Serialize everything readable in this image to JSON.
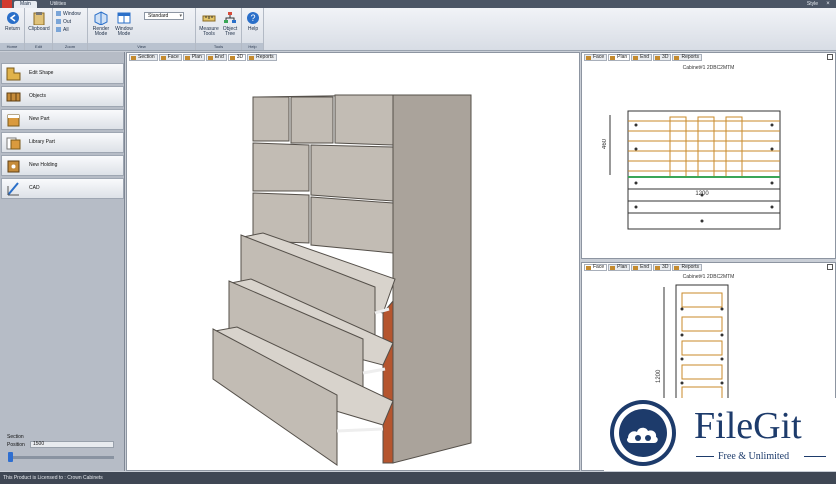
{
  "titlebar": {
    "tabs": [
      "Main",
      "Utilities"
    ],
    "style_label": "Style",
    "close_glyph": "×"
  },
  "ribbon": {
    "groups": [
      "Home",
      "Edit",
      "Zoom",
      "View",
      "Tools",
      "Help"
    ],
    "return_label": "Return",
    "clipboard_label": "Clipboard",
    "window_label": "Window",
    "out_label": "Out",
    "all_label": "All",
    "render_mode_label": "Render Mode",
    "window_mode_label": "Window Mode",
    "standard_value": "Standard",
    "measure_tools_label": "Measure Tools",
    "object_tree_label": "Object Tree",
    "help_label": "Help"
  },
  "left_panel": {
    "buttons": [
      {
        "label": "Edit Shape",
        "icon": "edit-shape-icon"
      },
      {
        "label": "Objects",
        "icon": "objects-icon"
      },
      {
        "label": "New Part",
        "icon": "new-part-icon"
      },
      {
        "label": "Library Part",
        "icon": "library-part-icon"
      },
      {
        "label": "New Holding",
        "icon": "new-holding-icon"
      },
      {
        "label": "CAD",
        "icon": "cad-icon"
      }
    ],
    "section_label": "Section",
    "position_label": "Position",
    "position_value": "1500"
  },
  "main_view": {
    "tabs": [
      "Section",
      "Face",
      "Plan",
      "End",
      "3D",
      "Reports"
    ],
    "active_tab": "3D"
  },
  "top_right_panel": {
    "tabs": [
      "Face",
      "Plan",
      "End",
      "3D",
      "Reports"
    ],
    "title": "Cabinet#1 2DBC2MTM",
    "dim_height": "460",
    "dim_width": "1200"
  },
  "bottom_right_panel": {
    "tabs": [
      "Face",
      "Plan",
      "End",
      "3D",
      "Reports"
    ],
    "title": "Cabinet#1 2DBC2MTM",
    "dim_height": "1200"
  },
  "status_bar": {
    "text": "This Product is Licensed to : Crown Cabinets"
  },
  "watermark": {
    "title": "FileGit",
    "subtitle": "Free & Unlimited"
  },
  "colors": {
    "panel_face": "#c2bcb4",
    "panel_top": "#d8d3cc",
    "panel_side": "#a9a29a",
    "edge_wood": "#b5552e",
    "brand": "#1d3b6b"
  }
}
